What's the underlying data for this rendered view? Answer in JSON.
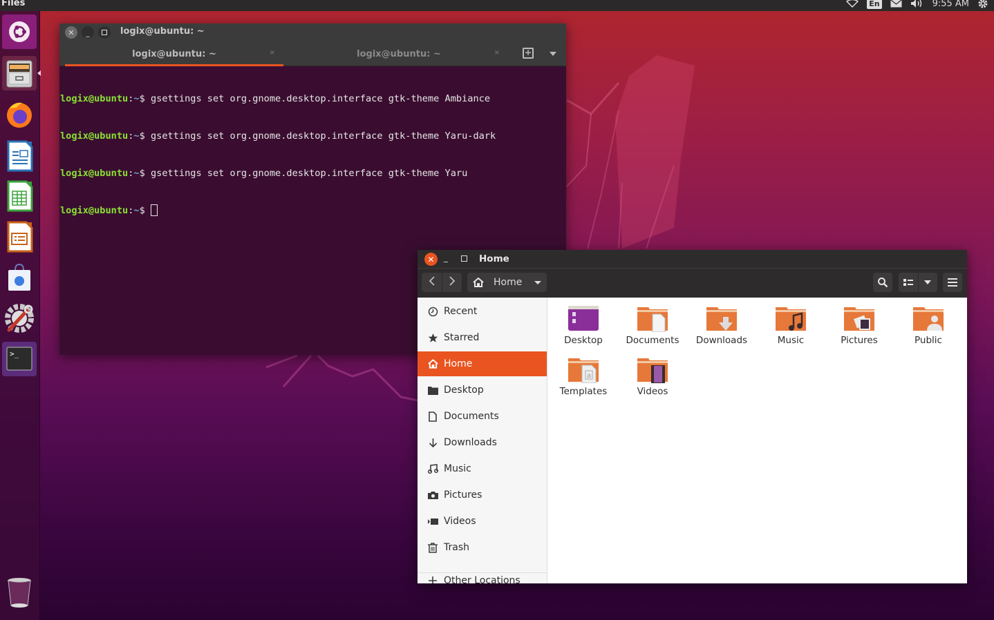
{
  "top_panel": {
    "app_name": "Files",
    "tray": {
      "network_icon": "network-icon",
      "keyboard_layout": "En",
      "mail_icon": "mail-icon",
      "volume_icon": "volume-icon",
      "clock": "9:55 AM",
      "settings_icon": "gear-icon"
    }
  },
  "launcher": {
    "items": [
      {
        "name": "Dash",
        "icon": "ubuntu-logo-icon"
      },
      {
        "name": "Files",
        "icon": "file-cabinet-icon",
        "active": true
      },
      {
        "name": "Firefox",
        "icon": "firefox-icon"
      },
      {
        "name": "LibreOffice Writer",
        "icon": "writer-icon"
      },
      {
        "name": "LibreOffice Calc",
        "icon": "calc-icon"
      },
      {
        "name": "LibreOffice Impress",
        "icon": "impress-icon"
      },
      {
        "name": "Ubuntu Software",
        "icon": "software-bag-icon"
      },
      {
        "name": "System Tools",
        "icon": "settings-wrench-icon"
      },
      {
        "name": "Terminal",
        "icon": "terminal-icon",
        "running": true
      },
      {
        "name": "Trash",
        "icon": "trash-icon"
      }
    ]
  },
  "terminal": {
    "title": "logix@ubuntu: ~",
    "tabs": [
      {
        "label": "logix@ubuntu: ~",
        "active": true
      },
      {
        "label": "logix@ubuntu: ~",
        "active": false
      }
    ],
    "tab_close": "×",
    "prompt_user": "logix@ubuntu",
    "prompt_sep": ":",
    "prompt_path": "~",
    "prompt_symbol": "$ ",
    "lines": [
      "gsettings set org.gnome.desktop.interface gtk-theme Ambiance",
      "gsettings set org.gnome.desktop.interface gtk-theme Yaru-dark",
      "gsettings set org.gnome.desktop.interface gtk-theme Yaru",
      ""
    ]
  },
  "files": {
    "title": "Home",
    "path_button": "Home",
    "sidebar": [
      {
        "label": "Recent",
        "icon": "clock-icon"
      },
      {
        "label": "Starred",
        "icon": "star-icon"
      },
      {
        "label": "Home",
        "icon": "home-icon",
        "selected": true
      },
      {
        "label": "Desktop",
        "icon": "folder-icon"
      },
      {
        "label": "Documents",
        "icon": "document-icon"
      },
      {
        "label": "Downloads",
        "icon": "download-arrow-icon"
      },
      {
        "label": "Music",
        "icon": "music-note-icon"
      },
      {
        "label": "Pictures",
        "icon": "camera-icon"
      },
      {
        "label": "Videos",
        "icon": "video-icon"
      },
      {
        "label": "Trash",
        "icon": "trash-icon"
      },
      {
        "label": "Other Locations",
        "icon": "plus-icon"
      }
    ],
    "items": [
      {
        "name": "Desktop",
        "icon": "desktop-folder-icon"
      },
      {
        "name": "Documents",
        "icon": "documents-folder-icon"
      },
      {
        "name": "Downloads",
        "icon": "downloads-folder-icon"
      },
      {
        "name": "Music",
        "icon": "music-folder-icon"
      },
      {
        "name": "Pictures",
        "icon": "pictures-folder-icon"
      },
      {
        "name": "Public",
        "icon": "public-folder-icon"
      },
      {
        "name": "Templates",
        "icon": "templates-folder-icon"
      },
      {
        "name": "Videos",
        "icon": "videos-folder-icon"
      }
    ]
  },
  "colors": {
    "accent": "#e95420",
    "prompt_user": "#8ae234",
    "prompt_path": "#729fcf",
    "terminal_bg": "#3a0d30",
    "folder": "#e6783a"
  }
}
